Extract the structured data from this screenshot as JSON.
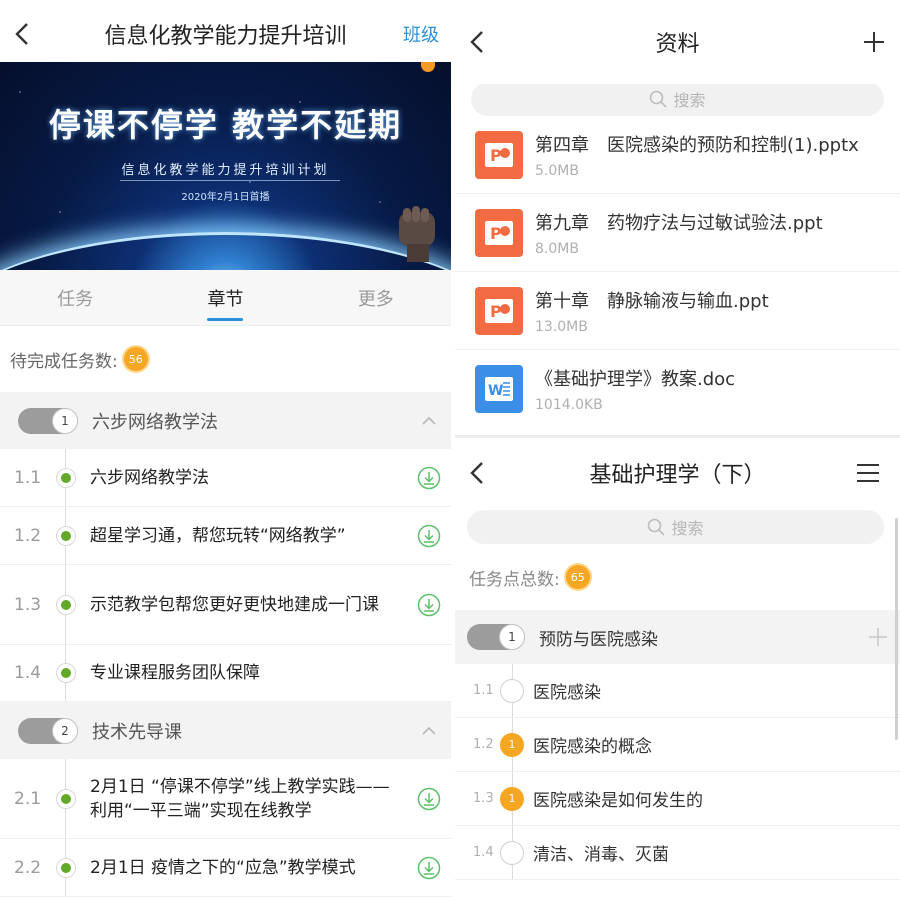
{
  "left": {
    "header": {
      "title": "信息化教学能力提升培训",
      "right_link": "班级"
    },
    "banner": {
      "slogan": "停课不停学  教学不延期",
      "plan": "信息化教学能力提升培训计划",
      "date": "2020年2月1日首播"
    },
    "tabs": [
      {
        "label": "任务",
        "active": false
      },
      {
        "label": "章节",
        "active": true
      },
      {
        "label": "更多",
        "active": false
      }
    ],
    "pending": {
      "label": "待完成任务数:",
      "count": "56"
    },
    "sections": [
      {
        "index": "1",
        "title": "六步网络教学法",
        "items": [
          {
            "num": "1.1",
            "text": "六步网络教学法",
            "download": true
          },
          {
            "num": "1.2",
            "text": "超星学习通，帮您玩转“网络教学”",
            "download": true
          },
          {
            "num": "1.3",
            "text": "示范教学包帮您更好更快地建成一门课",
            "download": true
          },
          {
            "num": "1.4",
            "text": "专业课程服务团队保障",
            "download": false
          }
        ]
      },
      {
        "index": "2",
        "title": "技术先导课",
        "items": [
          {
            "num": "2.1",
            "text": "2月1日 “停课不停学”线上教学实践——利用“一平三端”实现在线教学",
            "download": true
          },
          {
            "num": "2.2",
            "text": "2月1日 疫情之下的“应急”教学模式",
            "download": true
          }
        ]
      }
    ]
  },
  "right_top": {
    "header": {
      "title": "资料"
    },
    "search": {
      "placeholder": "搜索"
    },
    "files": [
      {
        "name": "第四章　医院感染的预防和控制(1).pptx",
        "size": "5.0MB",
        "type": "ppt"
      },
      {
        "name": "第九章　药物疗法与过敏试验法.ppt",
        "size": "8.0MB",
        "type": "ppt"
      },
      {
        "name": "第十章　静脉输液与输血.ppt",
        "size": "13.0MB",
        "type": "ppt"
      },
      {
        "name": "《基础护理学》教案.doc",
        "size": "1014.0KB",
        "type": "doc"
      }
    ]
  },
  "right_bottom": {
    "header": {
      "title": "基础护理学（下）"
    },
    "search": {
      "placeholder": "搜索"
    },
    "total": {
      "label": "任务点总数:",
      "count": "65"
    },
    "section": {
      "index": "1",
      "title": "预防与医院感染"
    },
    "items": [
      {
        "num": "1.1",
        "text": "医院感染",
        "task_count": ""
      },
      {
        "num": "1.2",
        "text": "医院感染的概念",
        "task_count": "1"
      },
      {
        "num": "1.3",
        "text": "医院感染是如何发生的",
        "task_count": "1"
      },
      {
        "num": "1.4",
        "text": "清洁、消毒、灭菌",
        "task_count": ""
      }
    ]
  },
  "colors": {
    "accent": "#2a8fd8",
    "badge": "#f5a623",
    "done_dot": "#62a829",
    "ppt": "#f26b43",
    "doc": "#3a8ee6"
  },
  "icons": [
    "back-arrow-icon",
    "plus-icon",
    "menu-icon",
    "search-icon",
    "download-icon",
    "chevron-up-icon",
    "ppt-file-icon",
    "word-file-icon"
  ]
}
